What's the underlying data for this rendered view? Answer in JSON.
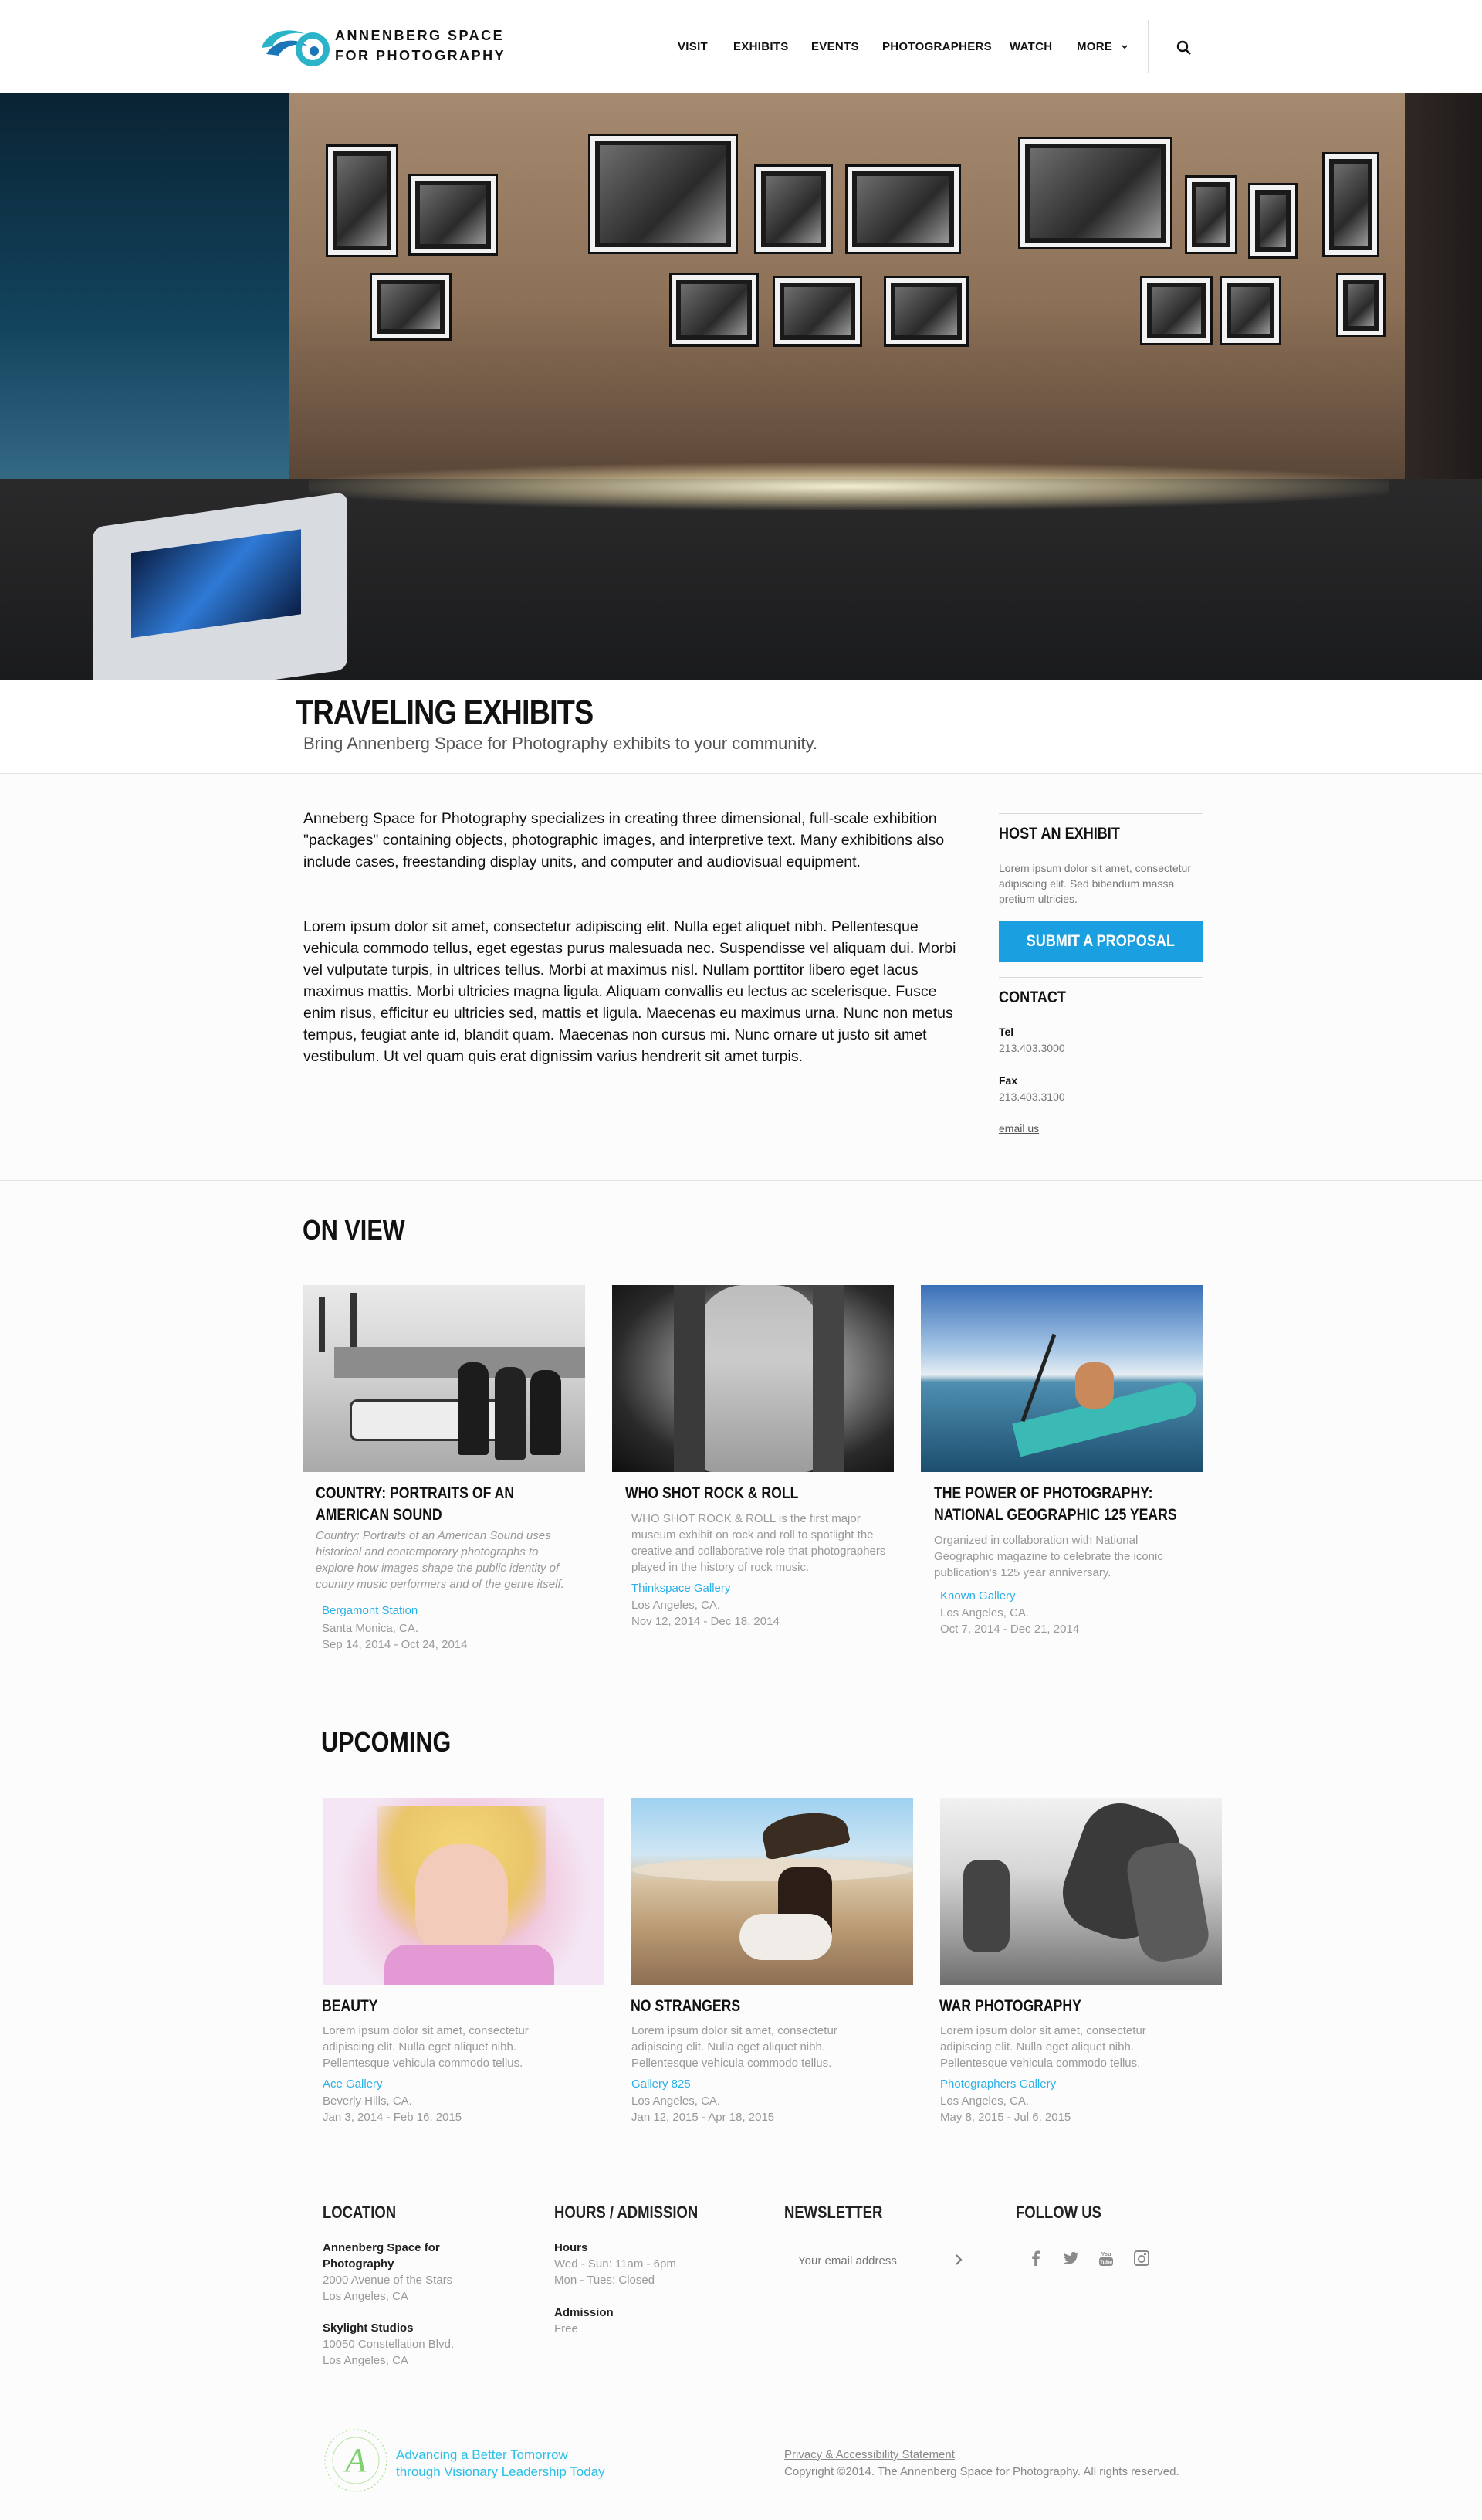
{
  "header": {
    "logo_line1": "ANNENBERG SPACE",
    "logo_line2": "FOR PHOTOGRAPHY",
    "nav": [
      "VISIT",
      "EXHIBITS",
      "EVENTS",
      "PHOTOGRAPHERS",
      "WATCH",
      "MORE"
    ],
    "colors": {
      "logo_teal": "#2ab3c9",
      "logo_blue": "#1a76b8"
    }
  },
  "hero": {
    "alt": "Exhibition hall with framed photographs on a curved illuminated wall"
  },
  "page": {
    "title": "TRAVELING EXHIBITS",
    "subtitle": "Bring Annenberg Space for Photography exhibits to your community."
  },
  "intro": {
    "p1": "Anneberg Space for Photography specializes in creating three dimensional, full-scale exhibition \"packages\" containing objects, photographic images, and interpretive text. Many exhibitions also include cases, freestanding display units, and computer and audiovisual equipment.",
    "p2": "Lorem ipsum dolor sit amet, consectetur adipiscing elit. Nulla eget aliquet nibh. Pellentesque vehicula commodo tellus, eget egestas purus malesuada nec. Suspendisse vel aliquam dui. Morbi vel vulputate turpis, in ultrices tellus. Morbi at maximus nisl. Nullam porttitor libero eget lacus maximus mattis. Morbi ultricies magna ligula. Aliquam convallis eu lectus ac scelerisque. Fusce enim risus, efficitur eu ultricies sed, mattis et ligula. Maecenas eu maximus urna. Nunc non metus tempus, feugiat ante id, blandit quam. Maecenas non cursus mi. Nunc ornare ut justo sit amet vestibulum. Ut vel quam quis erat dignissim varius hendrerit sit amet turpis."
  },
  "sidebar": {
    "host_title": "HOST AN EXHIBIT",
    "host_text": "Lorem ipsum dolor sit amet, consectetur adipiscing elit. Sed bibendum massa pretium ultricies.",
    "button": "SUBMIT A PROPOSAL",
    "contact_title": "CONTACT",
    "tel_label": "Tel",
    "tel": "213.403.3000",
    "fax_label": "Fax",
    "fax": "213.403.3100",
    "email": "email us",
    "accent": "#1a9fe0"
  },
  "on_view": {
    "title": "ON VIEW",
    "cards": [
      {
        "title": "COUNTRY: PORTRAITS OF AN AMERICAN SOUND",
        "desc": "Country: Portraits of an American Sound uses historical and contemporary photographs to explore how images shape the public identity of country music performers and of the genre itself.",
        "venue": "Bergamont Station",
        "city": "Santa Monica, CA.",
        "dates": "Sep 14, 2014 - Oct 24, 2014"
      },
      {
        "title": "WHO SHOT ROCK & ROLL",
        "desc": "WHO SHOT ROCK & ROLL is the first major museum exhibit on rock and roll to spotlight the creative and collaborative role that photographers played in the history of rock music.",
        "venue": "Thinkspace Gallery",
        "city": "Los Angeles, CA.",
        "dates": "Nov 12, 2014 - Dec 18, 2014"
      },
      {
        "title": "THE POWER OF PHOTOGRAPHY: NATIONAL GEOGRAPHIC 125 YEARS",
        "desc": "Organized in collaboration with National Geographic magazine to celebrate the iconic publication's 125 year anniversary.",
        "venue": "Known Gallery",
        "city": "Los Angeles, CA.",
        "dates": "Oct 7, 2014 - Dec 21, 2014"
      }
    ]
  },
  "upcoming": {
    "title": "UPCOMING",
    "cards": [
      {
        "title": "BEAUTY",
        "desc": "Lorem ipsum dolor sit amet, consectetur adipiscing elit. Nulla eget aliquet nibh. Pellentesque vehicula commodo tellus.",
        "venue": "Ace Gallery",
        "city": "Beverly Hills, CA.",
        "dates": "Jan 3, 2014 - Feb 16, 2015"
      },
      {
        "title": "NO STRANGERS",
        "desc": "Lorem ipsum dolor sit amet, consectetur adipiscing elit. Nulla eget aliquet nibh. Pellentesque vehicula commodo tellus.",
        "venue": "Gallery 825",
        "city": "Los Angeles, CA.",
        "dates": "Jan 12, 2015 - Apr 18, 2015"
      },
      {
        "title": "WAR PHOTOGRAPHY",
        "desc": "Lorem ipsum dolor sit amet, consectetur adipiscing elit. Nulla eget aliquet nibh. Pellentesque vehicula commodo tellus.",
        "venue": "Photographers Gallery",
        "city": "Los Angeles, CA.",
        "dates": "May 8, 2015 - Jul 6, 2015"
      }
    ]
  },
  "footer": {
    "location_title": "LOCATION",
    "loc1_name": "Annenberg Space for Photography",
    "loc1_addr1": "2000 Avenue of the Stars",
    "loc1_addr2": "Los Angeles, CA",
    "loc2_name": "Skylight Studios",
    "loc2_addr1": "10050 Constellation Blvd.",
    "loc2_addr2": "Los Angeles, CA",
    "hours_title": "HOURS / ADMISSION",
    "hours_label": "Hours",
    "hours1": "Wed - Sun: 11am - 6pm",
    "hours2": "Mon - Tues: Closed",
    "admission_label": "Admission",
    "admission": "Free",
    "newsletter_title": "NEWSLETTER",
    "newsletter_placeholder": "Your email address",
    "follow_title": "FOLLOW US",
    "social_icons": [
      "facebook-icon",
      "twitter-icon",
      "youtube-icon",
      "instagram-icon"
    ],
    "tagline1": "Advancing a Better Tomorrow",
    "tagline2": "through Visionary Leadership Today",
    "legal": "Privacy & Accessibility Statement",
    "copyright": "Copyright ©2014. The Annenberg Space for Photography. All rights reserved.",
    "accent": "#29c0e8"
  }
}
